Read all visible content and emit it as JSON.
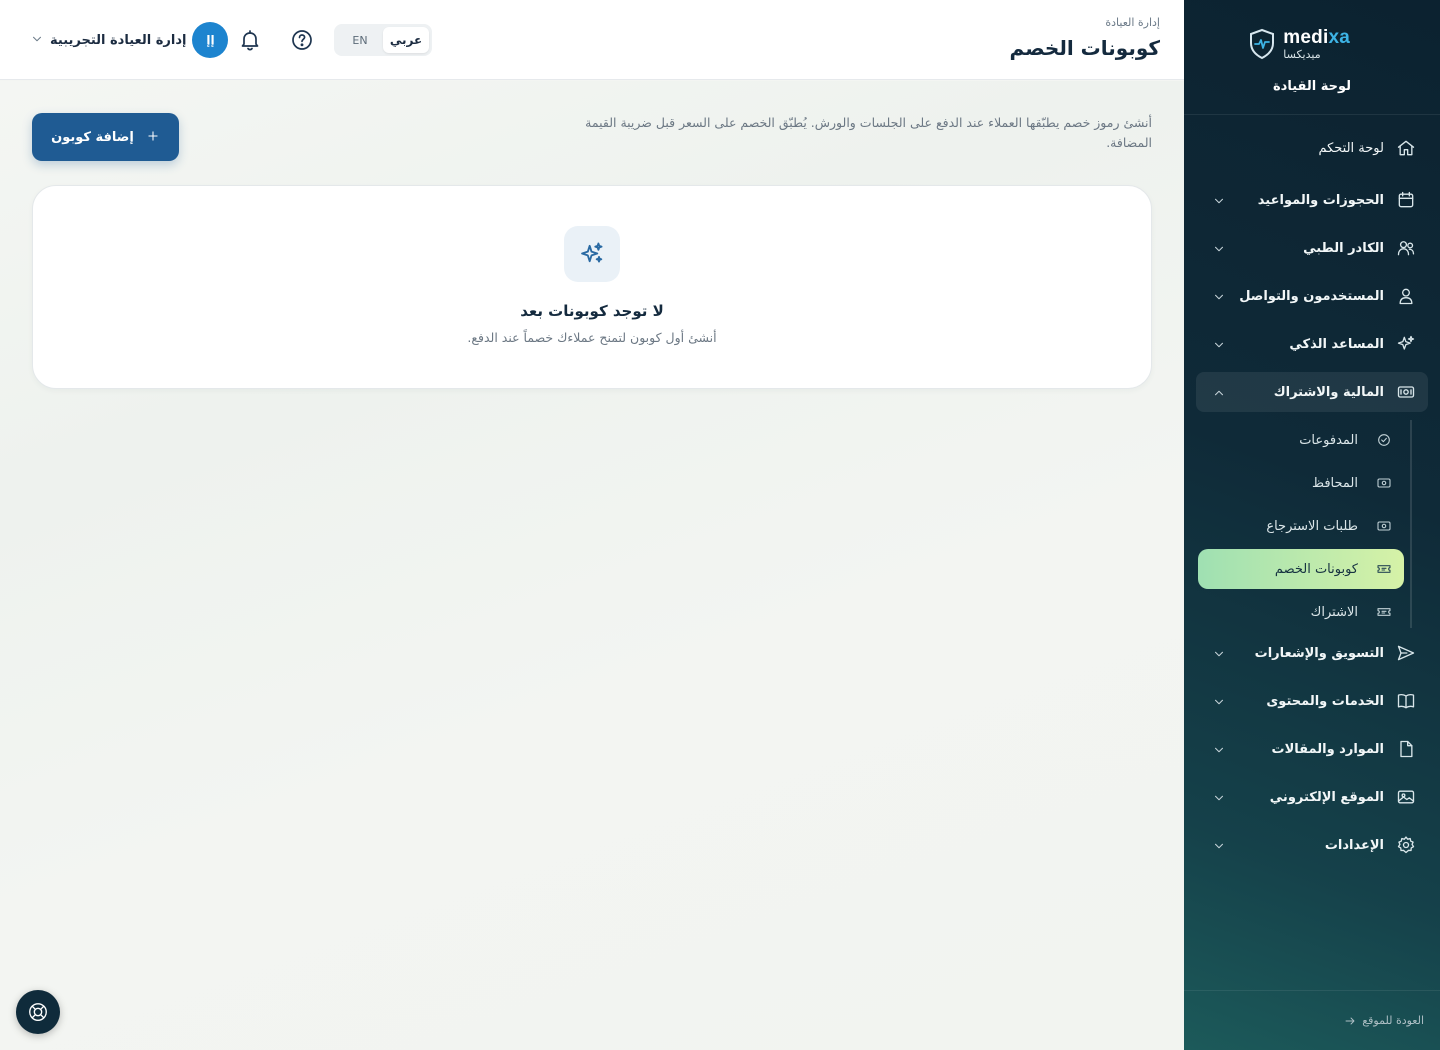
{
  "sidebar": {
    "brand_en_main": "medi",
    "brand_en_accent": "xa",
    "brand_ar": "ميديكسا",
    "subtitle": "لوحة القيادة",
    "items": [
      {
        "label": "لوحة التحكم",
        "icon": "home-icon"
      },
      {
        "label": "الحجوزات والمواعيد",
        "icon": "calendar-icon"
      },
      {
        "label": "الكادر الطبي",
        "icon": "users-icon"
      },
      {
        "label": "المستخدمون والتواصل",
        "icon": "user-icon"
      },
      {
        "label": "المساعد الذكي",
        "icon": "sparkles-icon"
      },
      {
        "label": "المالية والاشتراك",
        "icon": "banknote-icon"
      },
      {
        "label": "التسويق والإشعارات",
        "icon": "send-icon"
      },
      {
        "label": "الخدمات والمحتوى",
        "icon": "book-icon"
      },
      {
        "label": "الموارد والمقالات",
        "icon": "file-icon"
      },
      {
        "label": "الموقع الإلكتروني",
        "icon": "image-icon"
      },
      {
        "label": "الإعدادات",
        "icon": "settings-icon"
      }
    ],
    "finance_sub": [
      {
        "label": "المدفوعات",
        "icon": "check-circle-icon"
      },
      {
        "label": "المحافظ",
        "icon": "banknote-icon"
      },
      {
        "label": "طلبات الاسترجاع",
        "icon": "banknote-icon"
      },
      {
        "label": "كوبونات الخصم",
        "icon": "ticket-icon"
      },
      {
        "label": "الاشتراك",
        "icon": "ticket-icon"
      }
    ],
    "footer_link": "العودة للموقع"
  },
  "header": {
    "breadcrumb": "إدارة العيادة",
    "title": "كوبونات الخصم",
    "lang_ar": "عربي",
    "lang_en": "EN",
    "user_name": "إدارة العيادة التجريبية",
    "avatar_initials": "إإ"
  },
  "main": {
    "intro": "أنشئ رموز خصم يطبّقها العملاء عند الدفع على الجلسات والورش. يُطبّق الخصم على السعر قبل ضريبة القيمة المضافة.",
    "add_button": "إضافة كوبون",
    "empty_title": "لا توجد كوبونات بعد",
    "empty_text": "أنشئ أول كوبون لتمنح عملاءك خصماً عند الدفع."
  },
  "colors": {
    "primary": "#1f5b93",
    "active_sub_start": "#9fe0b2",
    "active_sub_end": "#d6f2a7",
    "sidebar_bg": "#0f2a38",
    "avatar": "#1d84cf"
  }
}
